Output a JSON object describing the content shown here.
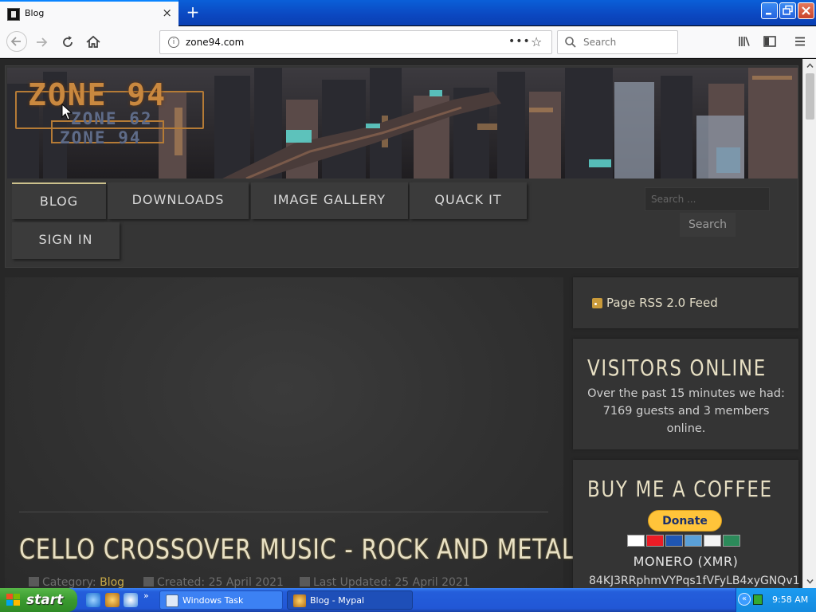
{
  "browser": {
    "tab_title": "Blog",
    "tab_close_glyph": "×",
    "new_tab_glyph": "+",
    "url": "zone94.com",
    "search_placeholder": "Search",
    "page_actions_glyph": "•••",
    "bookmark_glyph": "☆",
    "info_glyph": "i",
    "icons": {
      "back": "back-icon",
      "forward": "forward-icon",
      "reload": "reload-icon",
      "home": "home-icon",
      "library": "library-icon",
      "sidebar": "sidebar-icon",
      "menu": "hamburger-menu-icon"
    },
    "accent_color": "#0a84ff"
  },
  "site": {
    "logo_main": "ZONE 94",
    "logo_line2": "ZONE 62",
    "logo_line3": "ZONE 94",
    "nav": [
      "BLOG",
      "DOWNLOADS",
      "IMAGE GALLERY",
      "QUACK IT",
      "SIGN IN"
    ],
    "active_nav": "BLOG",
    "search_placeholder": "Search ...",
    "search_button": "Search",
    "accent_color": "#c7a948"
  },
  "article": {
    "title": "CELLO CROSSOVER MUSIC - ROCK AND METAL",
    "category_label": "Category:",
    "category_value": "Blog",
    "created": "Created: 25 April 2021",
    "updated": "Last Updated: 25 April 2021"
  },
  "sidebar": {
    "rss_label": "Page RSS 2.0 Feed",
    "visitors_heading": "VISITORS ONLINE",
    "visitors_text": "Over the past 15 minutes we had: 7169 guests and 3 members online.",
    "coffee_heading": "BUY ME A COFFEE",
    "donate_label": "Donate",
    "monero_label": "MONERO (XMR)",
    "monero_address": "84KJ3RRphmVYPqs1fVFyLB4xyGNQv1"
  },
  "taskbar": {
    "start_label": "start",
    "quicklaunch_overflow": "»",
    "tasks": [
      "Windows Task Manager",
      "Blog - Mypal"
    ],
    "tray_chevron": "«",
    "clock": "9:58 AM"
  }
}
